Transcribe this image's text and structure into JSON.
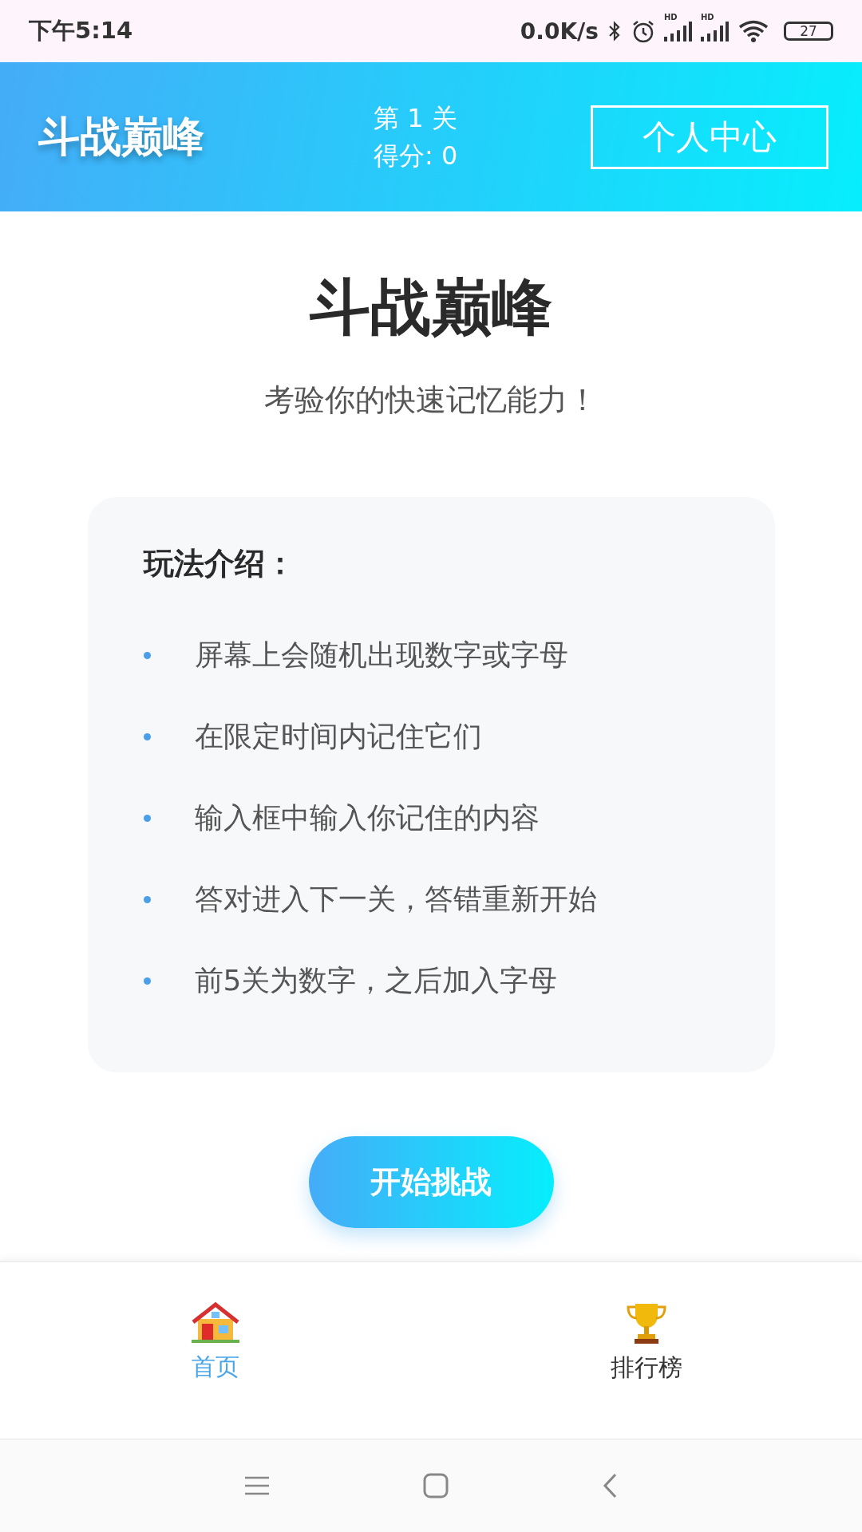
{
  "status_bar": {
    "time": "下午5:14",
    "net_speed": "0.0K/s",
    "signals": [
      "HD",
      "HD"
    ],
    "battery": "27"
  },
  "header": {
    "title": "斗战巅峰",
    "level": "第 1 关",
    "score": "得分: 0",
    "profile_button": "个人中心"
  },
  "hero": {
    "title": "斗战巅峰",
    "subtitle": "考验你的快速记忆能力！"
  },
  "rules": {
    "heading": "玩法介绍：",
    "items": [
      "屏幕上会随机出现数字或字母",
      "在限定时间内记住它们",
      "输入框中输入你记住的内容",
      "答对进入下一关，答错重新开始",
      "前5关为数字，之后加入字母"
    ]
  },
  "start_button": "开始挑战",
  "tabs": [
    {
      "label": "首页",
      "kind": "home",
      "selected": true
    },
    {
      "label": "排行榜",
      "kind": "trophy",
      "selected": false
    }
  ]
}
